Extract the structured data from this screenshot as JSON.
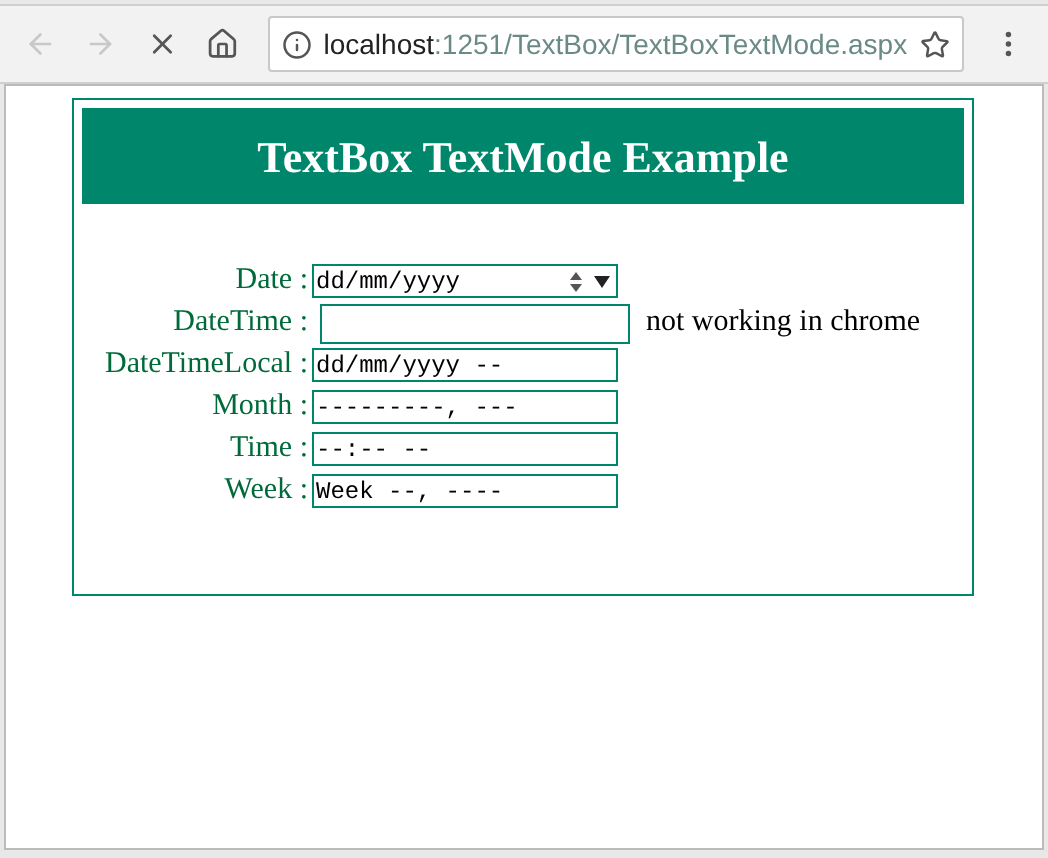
{
  "browser": {
    "back_disabled": true,
    "forward_disabled": true,
    "url_host": "localhost",
    "url_rest": ":1251/TextBox/TextBoxTextMode.aspx"
  },
  "header": {
    "title": "TextBox TextMode Example"
  },
  "fields": [
    {
      "label": "Date :",
      "kind": "date",
      "value": "dd/mm/yyyy"
    },
    {
      "label": "DateTime :",
      "kind": "text",
      "note": "not working in chrome"
    },
    {
      "label": "DateTimeLocal :",
      "kind": "plain",
      "value": "dd/mm/yyyy --"
    },
    {
      "label": "Month :",
      "kind": "plain",
      "value": "---------, ---"
    },
    {
      "label": "Time :",
      "kind": "plain",
      "value": "--:-- --"
    },
    {
      "label": "Week :",
      "kind": "plain",
      "value": "Week --, ----"
    }
  ]
}
